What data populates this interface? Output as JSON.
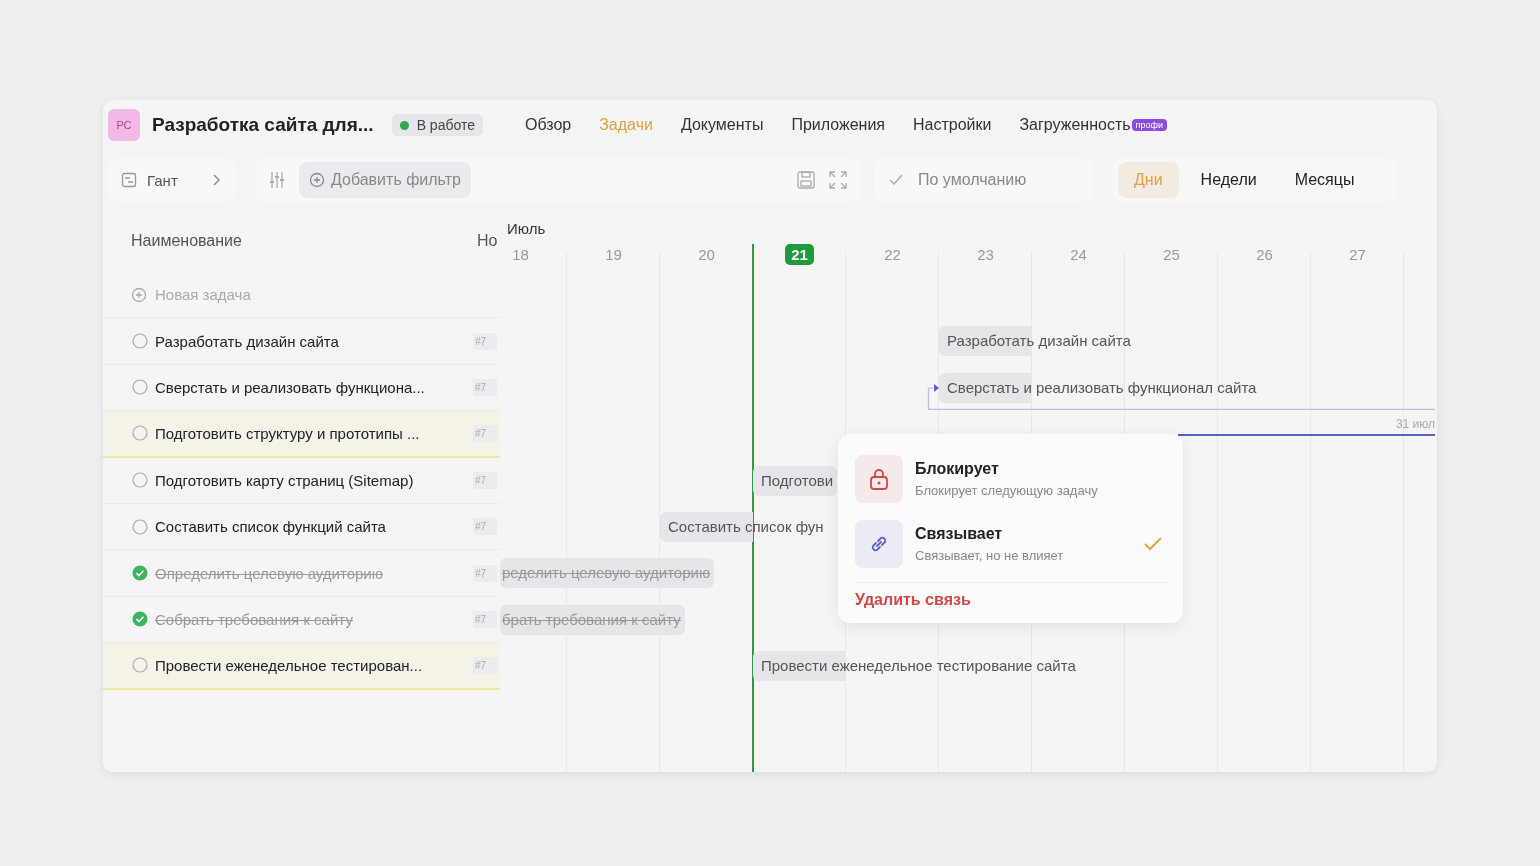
{
  "project": {
    "avatar": "РС",
    "title": "Разработка сайта для...",
    "status": {
      "label": "В работе",
      "color": "#2fa84f"
    }
  },
  "tabs": [
    {
      "label": "Обзор",
      "selected": false
    },
    {
      "label": "Задачи",
      "selected": true
    },
    {
      "label": "Документы",
      "selected": false
    },
    {
      "label": "Приложения",
      "selected": false
    },
    {
      "label": "Настройки",
      "selected": false
    },
    {
      "label": "Загруженность",
      "selected": false,
      "badge": "профи"
    }
  ],
  "toolbar": {
    "view": "Гант",
    "filter_button": "Добавить фильтр",
    "preset": "По умолчанию",
    "scales": [
      {
        "label": "Дни",
        "selected": true
      },
      {
        "label": "Недели",
        "selected": false
      },
      {
        "label": "Месяцы",
        "selected": false
      }
    ]
  },
  "table": {
    "columns": [
      "Наименование",
      "Но"
    ],
    "new_task": "Новая задача",
    "rows": [
      {
        "name": "Разработать дизайн сайта",
        "number": "#7",
        "done": false,
        "highlighted": false
      },
      {
        "name": "Сверстать и реализовать функциона...",
        "number": "#7",
        "done": false,
        "highlighted": false
      },
      {
        "name": "Подготовить структуру и прототипы ...",
        "number": "#7",
        "done": false,
        "highlighted": true
      },
      {
        "name": "Подготовить карту страниц (Sitemap)",
        "number": "#7",
        "done": false,
        "highlighted": false
      },
      {
        "name": "Составить список функций сайта",
        "number": "#7",
        "done": false,
        "highlighted": false
      },
      {
        "name": "Определить целевую аудиторию",
        "number": "#7",
        "done": true,
        "highlighted": false
      },
      {
        "name": "Собрать требования к сайту",
        "number": "#7",
        "done": true,
        "highlighted": false
      },
      {
        "name": "Провести еженедельное тестирован...",
        "number": "#7",
        "done": false,
        "highlighted": true
      }
    ]
  },
  "timeline": {
    "month": "Июль",
    "days": [
      {
        "label": "18",
        "today": false
      },
      {
        "label": "19",
        "today": false
      },
      {
        "label": "20",
        "today": false
      },
      {
        "label": "21",
        "today": true
      },
      {
        "label": "22",
        "today": false
      },
      {
        "label": "23",
        "today": false
      },
      {
        "label": "24",
        "today": false
      },
      {
        "label": "25",
        "today": false
      },
      {
        "label": "26",
        "today": false
      },
      {
        "label": "27",
        "today": false
      }
    ],
    "bars": [
      {
        "kind": "bar",
        "text": "Разработать дизайн сайта",
        "dependency": false
      },
      {
        "kind": "bar",
        "text": "Сверстать и реализовать функционал сайта",
        "dependency": true
      },
      {
        "kind": "line",
        "text": "31 июл"
      },
      {
        "kind": "bar",
        "text": "Подготови",
        "dependency": false
      },
      {
        "kind": "bar",
        "text": "Составить список фун",
        "dependency": false
      },
      {
        "kind": "bar",
        "text": "ределить целевую аудиторию",
        "dependency": false
      },
      {
        "kind": "bar",
        "text": "брать требования к сайту",
        "dependency": false
      },
      {
        "kind": "bar",
        "text": "Провести еженедельное тестирование сайта",
        "dependency": false
      }
    ]
  },
  "popup": {
    "options": [
      {
        "kind": "block",
        "title": "Блокирует",
        "subtitle": "Блокирует следующую задачу",
        "selected": false
      },
      {
        "kind": "link",
        "title": "Связывает",
        "subtitle": "Связывает, но не влияет",
        "selected": true
      }
    ],
    "delete": "Удалить связь"
  }
}
